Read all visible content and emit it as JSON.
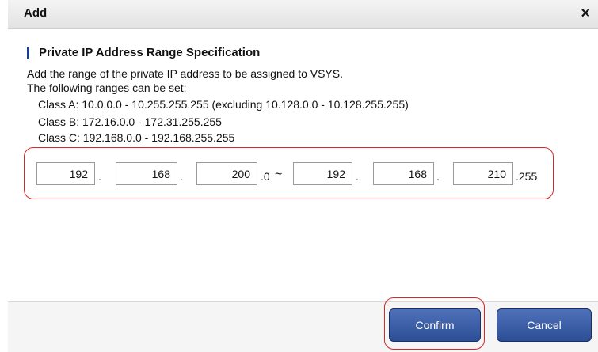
{
  "dialog": {
    "title": "Add",
    "close_glyph": "×"
  },
  "section": {
    "title": "Private IP Address Range Specification"
  },
  "description": {
    "line1": "Add the range of the private IP address to be assigned to VSYS.",
    "line2": "The following ranges can be set:",
    "class_a": "Class A: 10.0.0.0 - 10.255.255.255 (excluding 10.128.0.0 - 10.128.255.255)",
    "class_b": "Class B: 172.16.0.0 - 172.31.255.255",
    "class_c": "Class C: 192.168.0.0 - 192.168.255.255"
  },
  "range": {
    "start": {
      "octet1": "192",
      "octet2": "168",
      "octet3": "200",
      "suffix": ".0"
    },
    "separator": "~",
    "end": {
      "octet1": "192",
      "octet2": "168",
      "octet3": "210",
      "suffix": ".255"
    },
    "dot": "."
  },
  "buttons": {
    "confirm": "Confirm",
    "cancel": "Cancel"
  },
  "colors": {
    "highlight": "#d62828",
    "button": "#2c4e95",
    "section_bar": "#1a3e8c"
  },
  "icons": {
    "close": "close-icon"
  }
}
